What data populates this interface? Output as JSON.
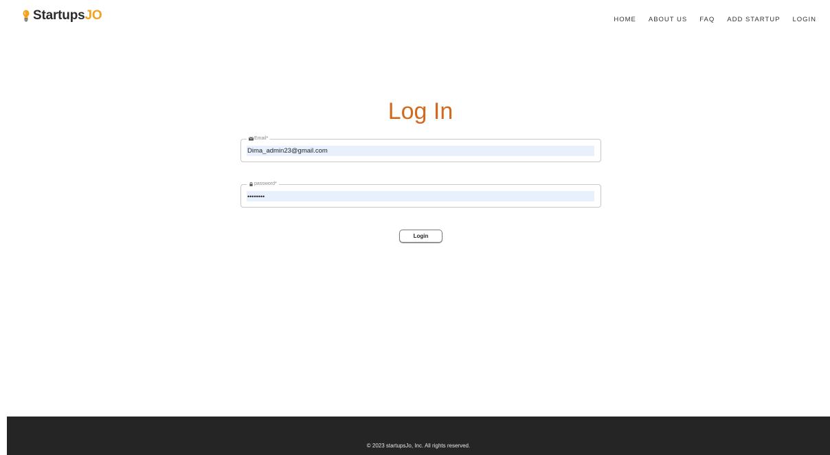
{
  "header": {
    "logo": {
      "icon": "lightbulb-icon",
      "text_main": "Startups",
      "text_accent": "JO",
      "accent_color": "#f3a21a"
    },
    "nav": [
      {
        "label": "HOME"
      },
      {
        "label": "ABOUT US"
      },
      {
        "label": "FAQ"
      },
      {
        "label": "ADD STARTUP"
      },
      {
        "label": "LOGIN"
      }
    ]
  },
  "login_form": {
    "title": "Log In",
    "title_color": "#d2691e",
    "email": {
      "icon": "envelope-icon",
      "label": "Email*",
      "value": "Dima_admin23@gmail.com"
    },
    "password": {
      "icon": "lock-icon",
      "label": "password*",
      "value": "••••••••"
    },
    "submit_label": "Login"
  },
  "footer": {
    "text": "© 2023 startupsJo, Inc. All rights reserved."
  }
}
